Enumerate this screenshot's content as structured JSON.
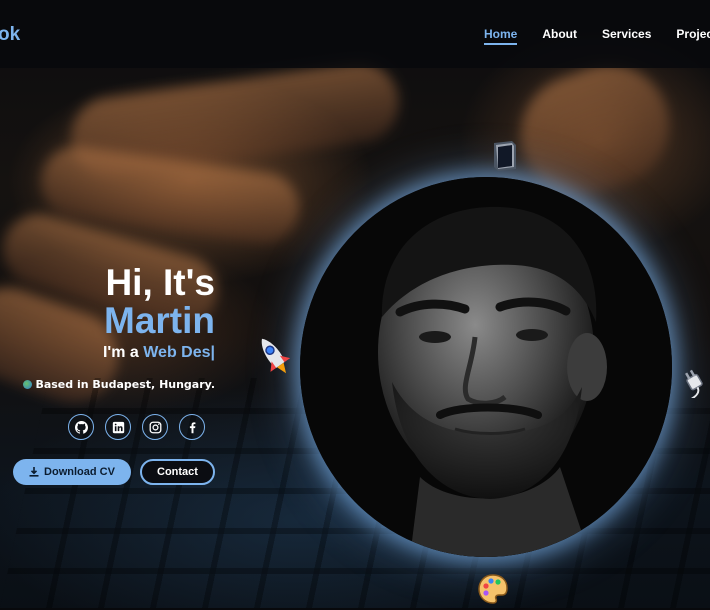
{
  "nav": {
    "logo": "ok",
    "links": [
      "Home",
      "About",
      "Services",
      "Projects"
    ],
    "active": "Home"
  },
  "hero": {
    "greeting": "Hi, It's",
    "name": "Martin",
    "role_prefix": "I'm a ",
    "role_typed": "Web Des|",
    "location": "Based in Budapest, Hungary."
  },
  "socials": [
    {
      "icon": "github-icon"
    },
    {
      "icon": "linkedin-icon"
    },
    {
      "icon": "instagram-icon"
    },
    {
      "icon": "facebook-icon"
    }
  ],
  "buttons": {
    "download_cv": "Download CV",
    "contact": "Contact"
  },
  "floating_icons": [
    "book-icon",
    "rocket-icon",
    "plug-icon",
    "palette-icon"
  ],
  "colors": {
    "accent": "#7db4ee",
    "background": "#08090c",
    "text": "#ffffff"
  }
}
